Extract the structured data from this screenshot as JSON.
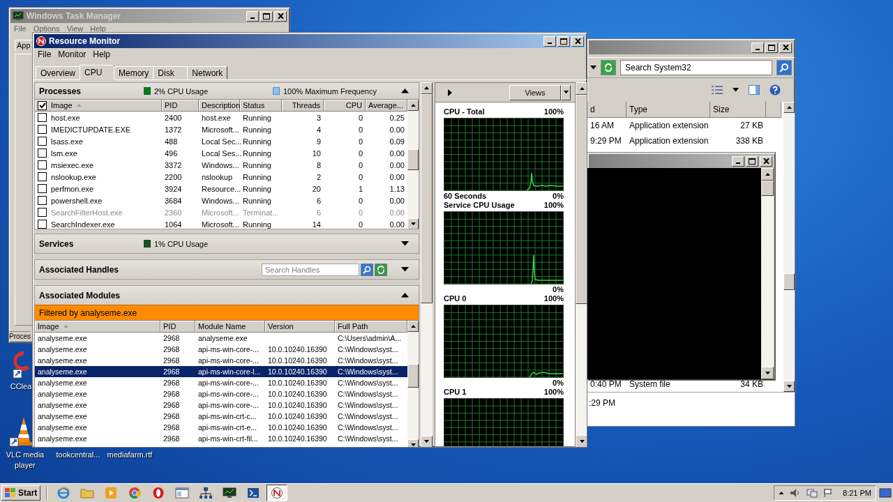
{
  "task_manager": {
    "title": "Windows Task Manager",
    "menu": [
      "File",
      "Options",
      "View",
      "Help"
    ],
    "tab": "App",
    "status": "Proces"
  },
  "explorer": {
    "search": {
      "placeholder": "Search System32"
    },
    "columns": [
      "d",
      "Type",
      "Size"
    ],
    "rows": [
      {
        "cells": [
          "16 AM",
          "Application extension",
          "27 KB"
        ]
      },
      {
        "cells": [
          "9:29 PM",
          "Application extension",
          "338 KB"
        ]
      },
      {
        "cells": [
          "0:40 PM",
          "System file",
          "34 KB"
        ]
      }
    ],
    "details": ":29 PM"
  },
  "resource_monitor": {
    "title": "Resource Monitor",
    "menu": [
      "File",
      "Monitor",
      "Help"
    ],
    "tabs": [
      {
        "label": "Overview",
        "selected": false
      },
      {
        "label": "CPU",
        "selected": true
      },
      {
        "label": "Memory",
        "selected": false
      },
      {
        "label": "Disk",
        "selected": false
      },
      {
        "label": "Network",
        "selected": false
      }
    ],
    "processes": {
      "title": "Processes",
      "cpu_usage": "2% CPU Usage",
      "frequency": "100% Maximum Frequency",
      "expanded": true,
      "header_checked": true,
      "columns": [
        "Image",
        "PID",
        "Description",
        "Status",
        "Threads",
        "CPU",
        "Average..."
      ],
      "rows": [
        {
          "checked": false,
          "disabled": false,
          "cells": [
            "host.exe",
            "2400",
            "host.exe",
            "Running",
            "3",
            "0",
            "0.25"
          ]
        },
        {
          "checked": false,
          "disabled": false,
          "cells": [
            "IMEDICTUPDATE.EXE",
            "1372",
            "Microsoft...",
            "Running",
            "4",
            "0",
            "0.00"
          ]
        },
        {
          "checked": false,
          "disabled": false,
          "cells": [
            "lsass.exe",
            "488",
            "Local Sec...",
            "Running",
            "9",
            "0",
            "0.09"
          ]
        },
        {
          "checked": false,
          "disabled": false,
          "cells": [
            "lsm.exe",
            "496",
            "Local Ses...",
            "Running",
            "10",
            "0",
            "0.00"
          ]
        },
        {
          "checked": false,
          "disabled": false,
          "cells": [
            "msiexec.exe",
            "3372",
            "Windows...",
            "Running",
            "8",
            "0",
            "0.00"
          ]
        },
        {
          "checked": false,
          "disabled": false,
          "cells": [
            "nslookup.exe",
            "2200",
            "nslookup",
            "Running",
            "2",
            "0",
            "0.00"
          ]
        },
        {
          "checked": false,
          "disabled": false,
          "cells": [
            "perfmon.exe",
            "3924",
            "Resource...",
            "Running",
            "20",
            "1",
            "1.13"
          ]
        },
        {
          "checked": false,
          "disabled": false,
          "cells": [
            "powershell.exe",
            "3684",
            "Windows...",
            "Running",
            "6",
            "0",
            "0.00"
          ]
        },
        {
          "checked": false,
          "disabled": true,
          "cells": [
            "SearchFilterHost.exe",
            "2360",
            "Microsoft...",
            "Terminat...",
            "6",
            "0",
            "0.00"
          ]
        },
        {
          "checked": false,
          "disabled": false,
          "cells": [
            "SearchIndexer.exe",
            "1064",
            "Microsoft...",
            "Running",
            "14",
            "0",
            "0.00"
          ]
        }
      ]
    },
    "services": {
      "title": "Services",
      "cpu_usage": "1% CPU Usage",
      "expanded": false
    },
    "handles": {
      "title": "Associated Handles",
      "search": {
        "placeholder": "Search Handles"
      },
      "expanded": false
    },
    "modules": {
      "title": "Associated Modules",
      "expanded": true,
      "filter": "Filtered by analyseme.exe",
      "columns": [
        "Image",
        "PID",
        "Module Name",
        "Version",
        "Full Path"
      ],
      "rows": [
        {
          "selected": false,
          "cells": [
            "analyseme.exe",
            "2968",
            "analyseme.exe",
            "",
            "C:\\Users\\admin\\A..."
          ]
        },
        {
          "selected": false,
          "cells": [
            "analyseme.exe",
            "2968",
            "api-ms-win-core-...",
            "10.0.10240.16390",
            "C:\\Windows\\syst..."
          ]
        },
        {
          "selected": false,
          "cells": [
            "analyseme.exe",
            "2968",
            "api-ms-win-core-...",
            "10.0.10240.16390",
            "C:\\Windows\\syst..."
          ]
        },
        {
          "selected": true,
          "cells": [
            "analyseme.exe",
            "2968",
            "api-ms-win-core-l...",
            "10.0.10240.16390",
            "C:\\Windows\\syst..."
          ]
        },
        {
          "selected": false,
          "cells": [
            "analyseme.exe",
            "2968",
            "api-ms-win-core-...",
            "10.0.10240.16390",
            "C:\\Windows\\syst..."
          ]
        },
        {
          "selected": false,
          "cells": [
            "analyseme.exe",
            "2968",
            "api-ms-win-core-...",
            "10.0.10240.16390",
            "C:\\Windows\\syst..."
          ]
        },
        {
          "selected": false,
          "cells": [
            "analyseme.exe",
            "2968",
            "api-ms-win-core-...",
            "10.0.10240.16390",
            "C:\\Windows\\syst..."
          ]
        },
        {
          "selected": false,
          "cells": [
            "analyseme.exe",
            "2968",
            "api-ms-win-crt-c...",
            "10.0.10240.16390",
            "C:\\Windows\\syst..."
          ]
        },
        {
          "selected": false,
          "cells": [
            "analyseme.exe",
            "2968",
            "api-ms-win-crt-e...",
            "10.0.10240.16390",
            "C:\\Windows\\syst..."
          ]
        },
        {
          "selected": false,
          "cells": [
            "analyseme.exe",
            "2968",
            "api-ms-win-crt-fil...",
            "10.0.10240.16390",
            "C:\\Windows\\syst..."
          ]
        }
      ]
    },
    "graphs": {
      "views": "Views",
      "items": [
        {
          "title": "CPU - Total",
          "max": "100%",
          "footer": "60 Seconds",
          "min": "0%"
        },
        {
          "title": "Service CPU Usage",
          "max": "100%",
          "min": "0%"
        },
        {
          "title": "CPU 0",
          "max": "100%",
          "min": "0%"
        },
        {
          "title": "CPU 1",
          "max": "100%"
        }
      ]
    }
  },
  "desktop_icons": [
    {
      "label": "CClea",
      "kind": "ccleaner"
    },
    {
      "label": "VLC media player",
      "kind": "vlc"
    },
    {
      "label": "tookcentral...",
      "kind": "none"
    },
    {
      "label": "mediafarm.rtf",
      "kind": "none"
    }
  ],
  "taskbar": {
    "start": "Start",
    "clock": "8:21 PM",
    "buttons": [
      {
        "kind": "ie",
        "selected": false
      },
      {
        "kind": "folder",
        "selected": false
      },
      {
        "kind": "media",
        "selected": false
      },
      {
        "kind": "chrome",
        "selected": false
      },
      {
        "kind": "opera",
        "selected": false
      },
      {
        "kind": "window",
        "selected": false
      },
      {
        "kind": "network",
        "selected": false
      },
      {
        "kind": "monitor",
        "selected": false
      },
      {
        "kind": "shell",
        "selected": false
      },
      {
        "kind": "resmon",
        "selected": true
      }
    ]
  }
}
